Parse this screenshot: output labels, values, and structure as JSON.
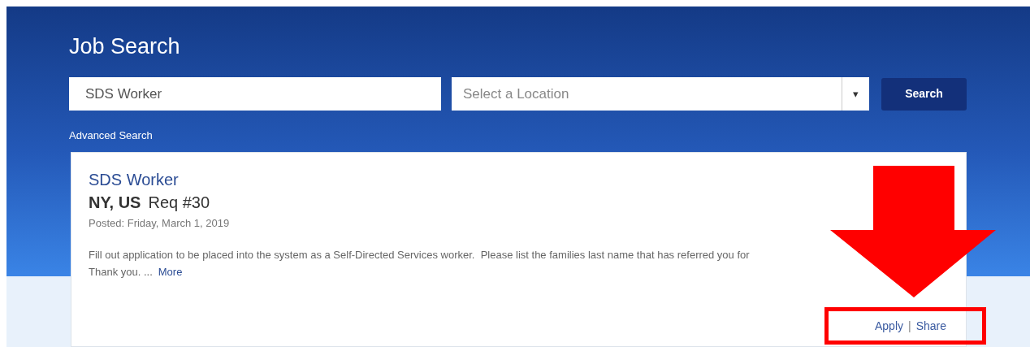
{
  "header": {
    "title": "Job Search"
  },
  "search": {
    "keyword_value": "SDS Worker",
    "location_placeholder": "Select a Location",
    "dropdown_caret": "▾",
    "button": "Search",
    "advanced_link": "Advanced Search"
  },
  "job": {
    "title": "SDS Worker",
    "location": "NY, US",
    "req": "Req #30",
    "posted": "Posted: Friday, March 1, 2019",
    "description_line": "Fill out application to be placed into the system as a Self-Directed Services worker.  Please list the families last name that has referred you for",
    "description_end": "Thank you. ...",
    "more_link": "More",
    "actions": [
      {
        "label": "Apply"
      },
      {
        "label": "Share"
      }
    ],
    "separator": "|"
  },
  "annotations": {
    "arrow": true,
    "highlight_box": true
  }
}
